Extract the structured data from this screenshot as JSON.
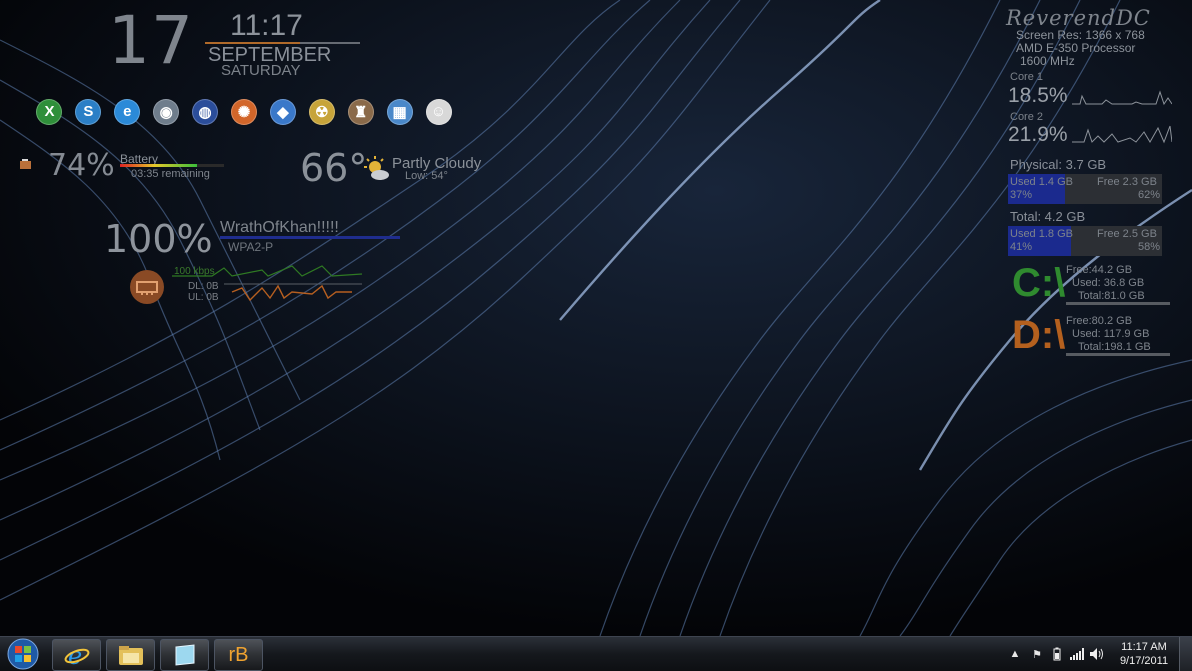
{
  "clock": {
    "day": "17",
    "time": "11:17",
    "month": "SEPTEMBER",
    "weekday": "SATURDAY"
  },
  "launcher": {
    "items": [
      {
        "icon": "excel-icon",
        "color": "#2f8f3a"
      },
      {
        "icon": "skype-icon",
        "color": "#2b7fc6"
      },
      {
        "icon": "internet-explorer-icon",
        "color": "#2b8ad8"
      },
      {
        "icon": "steam-icon",
        "color": "#6f7d8c"
      },
      {
        "icon": "firefox-icon",
        "color": "#2b4d9a"
      },
      {
        "icon": "ubuntu-icon",
        "color": "#d2662a"
      },
      {
        "icon": "games-icon",
        "color": "#3a78c9"
      },
      {
        "icon": "fallout-icon",
        "color": "#c7a43a"
      },
      {
        "icon": "crest-icon",
        "color": "#8a6a4a"
      },
      {
        "icon": "control-panel-icon",
        "color": "#4a88c9"
      },
      {
        "icon": "portrait-icon",
        "color": "#d8d8d8"
      }
    ]
  },
  "battery": {
    "percent": "74%",
    "label": "Battery",
    "remaining": "03:35 remaining",
    "level": 0.74
  },
  "weather": {
    "temp": "66°",
    "condition": "Partly Cloudy",
    "low": "Low: 54°"
  },
  "wifi": {
    "percent": "100%",
    "ssid": "WrathOfKhan!!!!!",
    "security": "WPA2-P"
  },
  "network": {
    "upload_rate": "100 kbps",
    "dl": "DL: 0B",
    "ul": "UL: 0B"
  },
  "system": {
    "user": "ReverendDC",
    "screen_res": "Screen Res: 1366 x 768",
    "cpu_name": "AMD E-350 Processor",
    "cpu_speed": "1600 MHz",
    "core1_label": "Core 1",
    "core1_value": "18.5%",
    "core2_label": "Core 2",
    "core2_value": "21.9%"
  },
  "memory": {
    "physical": {
      "title": "Physical: 3.7 GB",
      "used": "Used 1.4 GB",
      "free": "Free 2.3 GB",
      "used_pct": "37%",
      "free_pct": "62%",
      "used_fraction": 0.37
    },
    "total": {
      "title": "Total: 4.2 GB",
      "used": "Used 1.8 GB",
      "free": "Free 2.5 GB",
      "used_pct": "41%",
      "free_pct": "58%",
      "used_fraction": 0.41
    }
  },
  "drives": [
    {
      "letter": "C:\\",
      "free": "Free:44.2 GB",
      "used": "Used: 36.8 GB",
      "total": "Total:81.0 GB",
      "color": "#2f8a2f"
    },
    {
      "letter": "D:\\",
      "free": "Free:80.2 GB",
      "used": "Used: 117.9 GB",
      "total": "Total:198.1 GB",
      "color": "#b4601e"
    }
  ],
  "taskbar": {
    "pinned": [
      {
        "icon": "internet-explorer-icon"
      },
      {
        "icon": "file-explorer-icon"
      },
      {
        "icon": "windows-app-icon"
      },
      {
        "icon": "rainbar-icon",
        "label": "rB"
      }
    ],
    "tray_time": "11:17 AM",
    "tray_date": "9/17/2011"
  },
  "colors": {
    "accent_orange": "#b06a2a",
    "wifi_blue": "#1f2d8e",
    "memory_blue": "#1b2a8e"
  }
}
